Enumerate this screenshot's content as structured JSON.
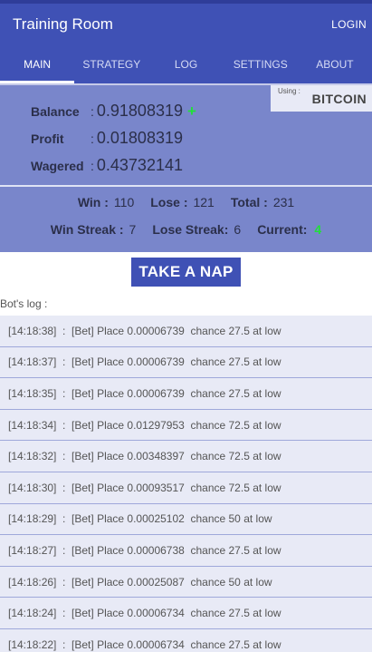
{
  "app": {
    "title": "Training Room",
    "login_label": "LOGIN"
  },
  "tabs": [
    {
      "label": "MAIN",
      "active": true
    },
    {
      "label": "STRATEGY",
      "active": false
    },
    {
      "label": "LOG",
      "active": false
    },
    {
      "label": "SETTINGS",
      "active": false
    },
    {
      "label": "ABOUT",
      "active": false
    }
  ],
  "using": {
    "label": "Using :",
    "value": "BITCOIN"
  },
  "stats": {
    "balance_label": "Balance",
    "balance_value": "0.91808319",
    "balance_indicator": "+",
    "profit_label": "Profit",
    "profit_value": "0.01808319",
    "wagered_label": "Wagered",
    "wagered_value": "0.43732141",
    "colon": ":"
  },
  "counts": {
    "win_label": "Win :",
    "win_value": "110",
    "lose_label": "Lose :",
    "lose_value": "121",
    "total_label": "Total :",
    "total_value": "231",
    "win_streak_label": "Win Streak :",
    "win_streak_value": "7",
    "lose_streak_label": "Lose Streak:",
    "lose_streak_value": "6",
    "current_label": "Current:",
    "current_value": "4"
  },
  "nap_button": "TAKE A NAP",
  "log": {
    "title": "Bot's log :",
    "entries": [
      "[14:18:38]  :  [Bet] Place 0.00006739  chance 27.5 at low",
      "[14:18:37]  :  [Bet] Place 0.00006739  chance 27.5 at low",
      "[14:18:35]  :  [Bet] Place 0.00006739  chance 27.5 at low",
      "[14:18:34]  :  [Bet] Place 0.01297953  chance 72.5 at low",
      "[14:18:32]  :  [Bet] Place 0.00348397  chance 72.5 at low",
      "[14:18:30]  :  [Bet] Place 0.00093517  chance 72.5 at low",
      "[14:18:29]  :  [Bet] Place 0.00025102  chance 50 at low",
      "[14:18:27]  :  [Bet] Place 0.00006738  chance 27.5 at low",
      "[14:18:26]  :  [Bet] Place 0.00025087  chance 50 at low",
      "[14:18:24]  :  [Bet] Place 0.00006734  chance 27.5 at low",
      "[14:18:22]  :  [Bet] Place 0.00006734  chance 27.5 at low"
    ]
  },
  "colors": {
    "primary": "#3f51b5",
    "panel": "#7986cb",
    "log_row": "#e8eaf6",
    "positive": "#22e03a"
  }
}
